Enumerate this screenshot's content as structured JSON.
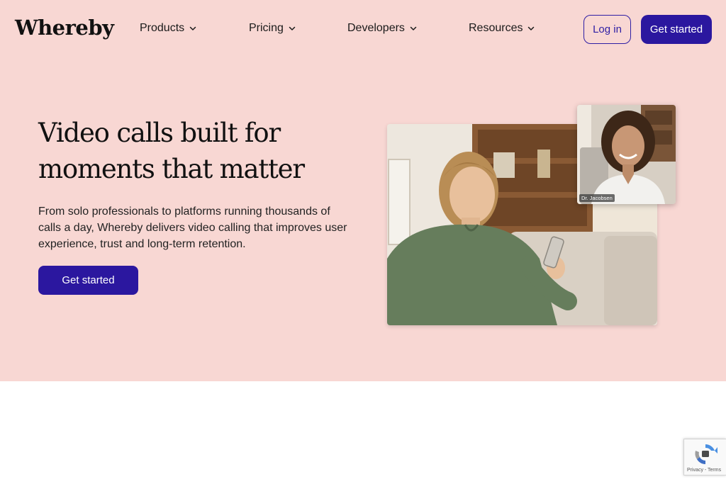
{
  "nav": {
    "logo": "Whereby",
    "items": [
      {
        "label": "Products"
      },
      {
        "label": "Pricing"
      },
      {
        "label": "Developers"
      },
      {
        "label": "Resources"
      }
    ],
    "login_label": "Log in",
    "get_started_label": "Get started"
  },
  "hero": {
    "headline": "Video calls built for moments that matter",
    "subtext": "From solo professionals to platforms running thousands of calls a day, Whereby delivers video calling that improves user experience, trust and long-term retention.",
    "cta_label": "Get started",
    "pip_name": "Dr. Jacobsen"
  },
  "recaptcha": {
    "links": "Privacy - Terms"
  },
  "colors": {
    "hero_bg": "#f8d7d3",
    "brand": "#2b179f"
  },
  "icons": [
    "chevron-down-icon",
    "recaptcha-icon"
  ]
}
